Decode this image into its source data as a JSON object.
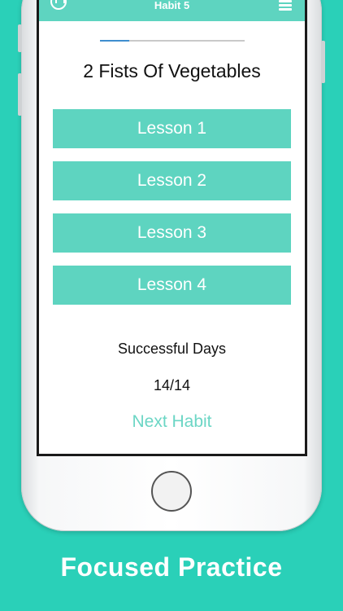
{
  "navbar": {
    "title": "Habit 5",
    "left_icon": "dumbbell-icon",
    "right_icon": "menu-icon"
  },
  "progress": {
    "fraction": 0.2
  },
  "habit": {
    "title": "2 Fists Of Vegetables"
  },
  "lessons": [
    {
      "label": "Lesson 1"
    },
    {
      "label": "Lesson 2"
    },
    {
      "label": "Lesson 3"
    },
    {
      "label": "Lesson 4"
    }
  ],
  "stats": {
    "label": "Successful Days",
    "count": "14/14"
  },
  "next_habit_label": "Next Habit",
  "tagline": "Focused Practice",
  "colors": {
    "background": "#2ad0b8",
    "accent": "#5ed4c0",
    "link": "#6cd6c5",
    "progress": "#3f8ecf"
  }
}
